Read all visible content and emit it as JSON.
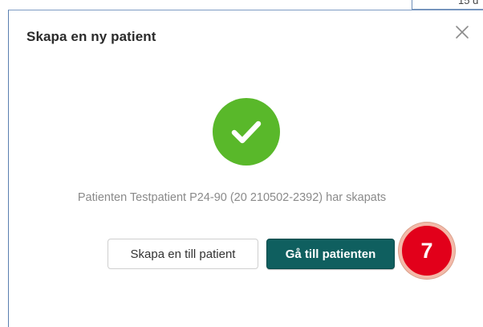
{
  "background": {
    "peek_text": "15 d"
  },
  "dialog": {
    "title": "Skapa en ny patient",
    "close_icon": "close-icon",
    "success_icon": "checkmark-circle-icon",
    "message": "Patienten Testpatient P24-90 (20 210502-2392) har skapats",
    "buttons": {
      "create_another": "Skapa en till patient",
      "go_to_patient": "Gå till patienten"
    }
  },
  "annotation": {
    "step_number": "7"
  },
  "colors": {
    "success": "#59b82a",
    "primary_button": "#0f5f5f",
    "step_badge": "#e2001a"
  }
}
